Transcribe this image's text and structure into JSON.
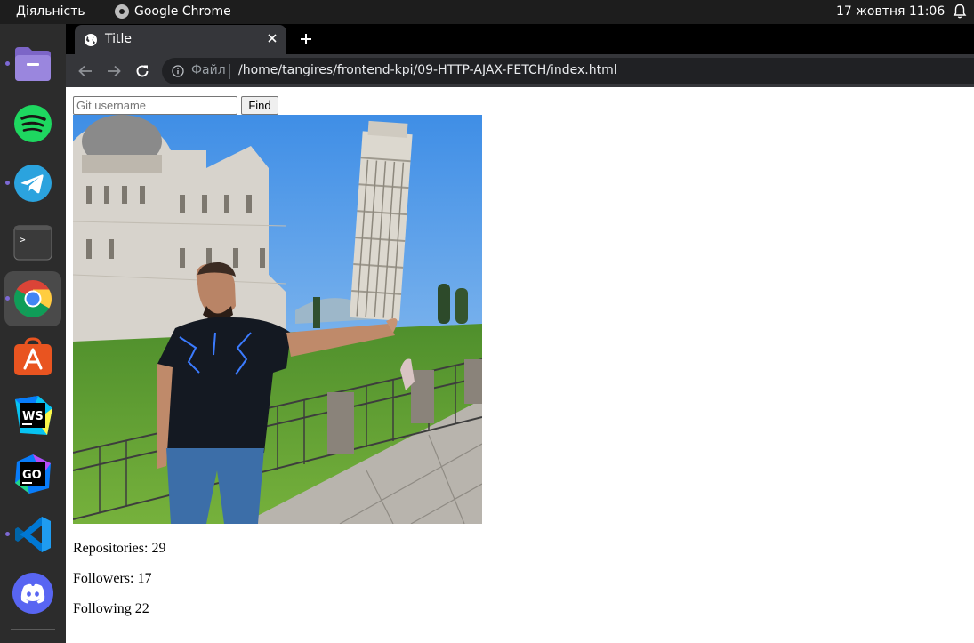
{
  "topbar": {
    "activities_label": "Діяльність",
    "app_name": "Google Chrome",
    "clock": "17 жовтня  11:06"
  },
  "dock": {
    "items": [
      "files-icon",
      "spotify-icon",
      "telegram-icon",
      "terminal-icon",
      "chrome-icon",
      "app-center-icon",
      "webstorm-icon",
      "goland-icon",
      "vscode-icon",
      "discord-icon"
    ],
    "webstorm_badge": "WS",
    "goland_badge": "GO",
    "terminal_prompt": ">_"
  },
  "browser": {
    "tab_title": "Title",
    "url_scheme_label": "Файл",
    "url": "/home/tangires/frontend-kpi/09-HTTP-AJAX-FETCH/index.html"
  },
  "page": {
    "search": {
      "placeholder": "Git username",
      "value": ""
    },
    "find_button": "Find",
    "repositories": "Repositories: 29",
    "followers": "Followers: 17",
    "following": "Following 22"
  },
  "colors": {
    "dock_indicator": "#7d69d4",
    "tab_active": "#35363a",
    "omnibox_bg": "#202124"
  }
}
